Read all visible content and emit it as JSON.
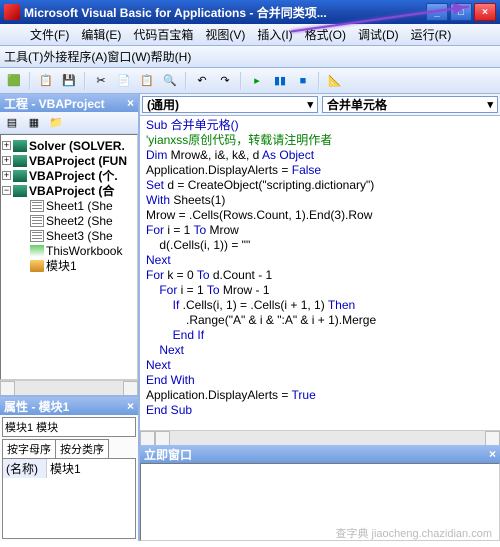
{
  "title": "Microsoft Visual Basic for Applications - 合并同类项...",
  "menu1": {
    "file": "文件(F)",
    "edit": "编辑(E)",
    "codebox": "代码百宝箱",
    "view": "视图(V)",
    "insert": "插入(I)",
    "format": "格式(O)",
    "debug": "调试(D)",
    "run": "运行(R)"
  },
  "menu2": {
    "tools": "工具(T)",
    "addins": "外接程序(A)",
    "window": "窗口(W)",
    "help": "帮助(H)"
  },
  "projPanel": {
    "title": "工程 - VBAProject"
  },
  "tree": {
    "solver": "Solver (SOLVER.",
    "funcres": "VBAProject (FUN",
    "gr": "VBAProject (个.",
    "hb": "VBAProject (合",
    "s1": "Sheet1 (She",
    "s2": "Sheet2 (She",
    "s3": "Sheet3 (She",
    "twb": "ThisWorkbook",
    "mod": "模块1"
  },
  "propPanel": {
    "title": "属性 - 模块1",
    "sel": "模块1 模块",
    "tab1": "按字母序",
    "tab2": "按分类序",
    "name_lbl": "(名称)",
    "name_val": "模块1"
  },
  "combos": {
    "left": "(通用)",
    "right": "合并单元格"
  },
  "code": {
    "l1": "Sub 合并单元格()",
    "l2": "'yianxss原创代码，转载请注明作者",
    "l3": "Dim Mrow&, i&, k&, d As Object",
    "l4": "Application.DisplayAlerts = False",
    "l5": "Set d = CreateObject(\"scripting.dictionary\")",
    "l6": "With Sheets(1)",
    "l7": "Mrow = .Cells(Rows.Count, 1).End(3).Row",
    "l8": "For i = 1 To Mrow",
    "l9": "    d(.Cells(i, 1)) = \"\"",
    "l10": "Next",
    "l11": "For k = 0 To d.Count - 1",
    "l12": "    For i = 1 To Mrow - 1",
    "l13": "        If .Cells(i, 1) = .Cells(i + 1, 1) Then",
    "l14": "            .Range(\"A\" & i & \":A\" & i + 1).Merge",
    "l15": "        End If",
    "l16": "    Next",
    "l17": "Next",
    "l18": "End With",
    "l19": "Application.DisplayAlerts = True",
    "l20": "End Sub"
  },
  "immediate": {
    "title": "立即窗口"
  },
  "watermark": "查字典 jiaocheng.chazidian.com"
}
